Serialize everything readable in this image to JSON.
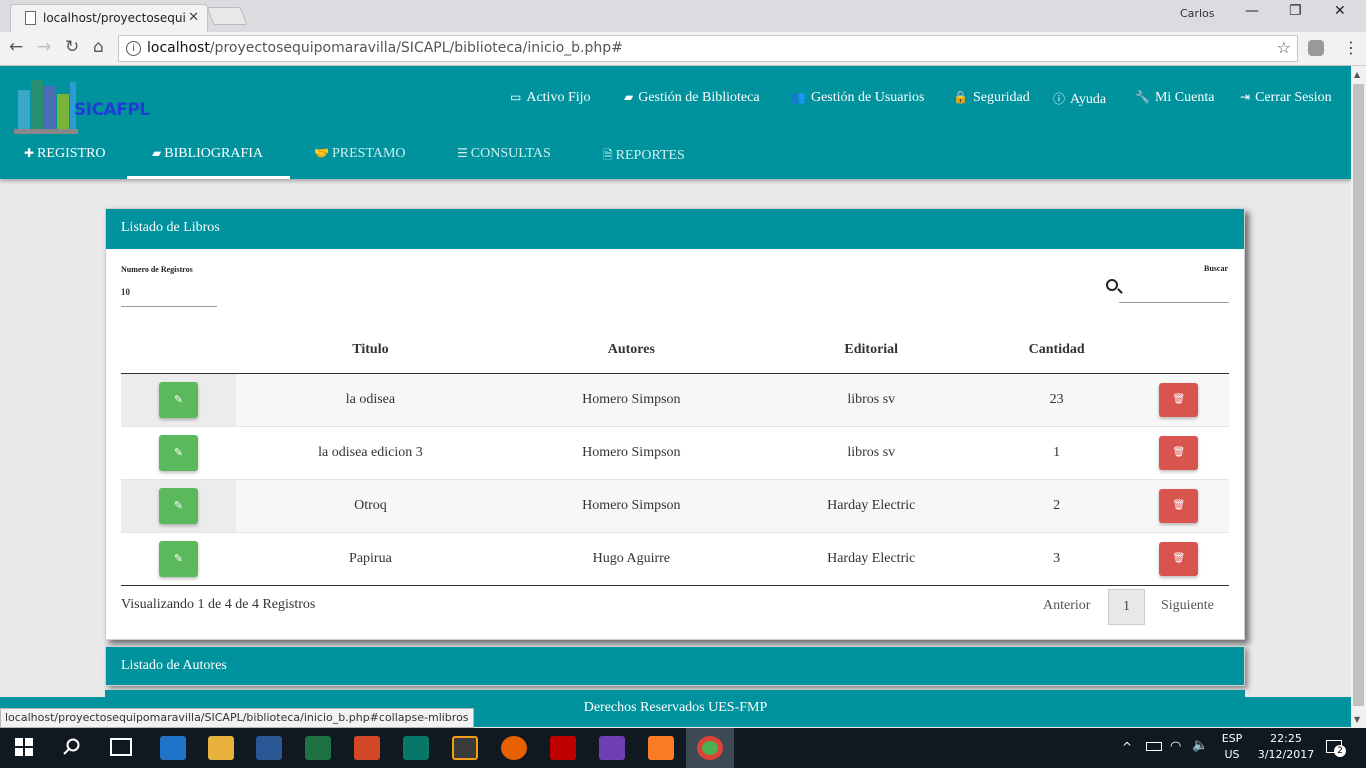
{
  "browser": {
    "tab_title": "localhost/proyectosequi",
    "user": "Carlos",
    "url_host": "localhost",
    "url_path": "/proyectosequipomaravilla/SICAPL/biblioteca/inicio_b.php#",
    "status_url": "localhost/proyectosequipomaravilla/SICAPL/biblioteca/inicio_b.php#collapse-mlibros"
  },
  "header": {
    "logo_text": "SICAFPL",
    "top_nav": [
      {
        "label": "Activo Fijo",
        "icon": "monitor-icon"
      },
      {
        "label": "Gestión de Biblioteca",
        "icon": "book-icon"
      },
      {
        "label": "Gestión de Usuarios",
        "icon": "users-icon"
      },
      {
        "label": "Seguridad",
        "icon": "lock-icon"
      },
      {
        "label": "Ayuda",
        "icon": "info-icon"
      },
      {
        "label": "Mi Cuenta",
        "icon": "wrench-icon"
      },
      {
        "label": "Cerrar Sesion",
        "icon": "sign-out-icon"
      }
    ],
    "sub_nav": [
      {
        "label": "REGISTRO",
        "icon": "plus-icon"
      },
      {
        "label": "BIBLIOGRAFIA",
        "icon": "book-icon",
        "active": true
      },
      {
        "label": "PRESTAMO",
        "icon": "handshake-icon"
      },
      {
        "label": "CONSULTAS",
        "icon": "list-icon"
      },
      {
        "label": "REPORTES",
        "icon": "pdf-icon"
      }
    ]
  },
  "panel": {
    "title": "Listado de Libros",
    "records_label": "Numero de Registros",
    "records_value": "10",
    "search_label": "Buscar",
    "columns": [
      "Titulo",
      "Autores",
      "Editorial",
      "Cantidad"
    ],
    "rows": [
      {
        "titulo": "la odisea",
        "autores": "Homero Simpson",
        "editorial": "libros sv",
        "cantidad": "23"
      },
      {
        "titulo": "la odisea edicion 3",
        "autores": "Homero Simpson",
        "editorial": "libros sv",
        "cantidad": "1"
      },
      {
        "titulo": "Otroq",
        "autores": "Homero Simpson",
        "editorial": "Harday Electric",
        "cantidad": "2"
      },
      {
        "titulo": "Papirua",
        "autores": "Hugo Aguirre",
        "editorial": "Harday Electric",
        "cantidad": "3"
      }
    ],
    "showing": "Visualizando 1 de 4 de 4 Registros",
    "prev": "Anterior",
    "page": "1",
    "next": "Siguiente"
  },
  "panel2_title": "Listado de Autores",
  "footer": "Derechos Reservados UES-FMP",
  "taskbar": {
    "lang": "ESP",
    "region": "US",
    "time": "22:25",
    "date": "3/12/2017",
    "notifications": "2"
  },
  "colors": {
    "brand": "#00939e",
    "edit": "#5cb85c",
    "delete": "#d9534f"
  }
}
